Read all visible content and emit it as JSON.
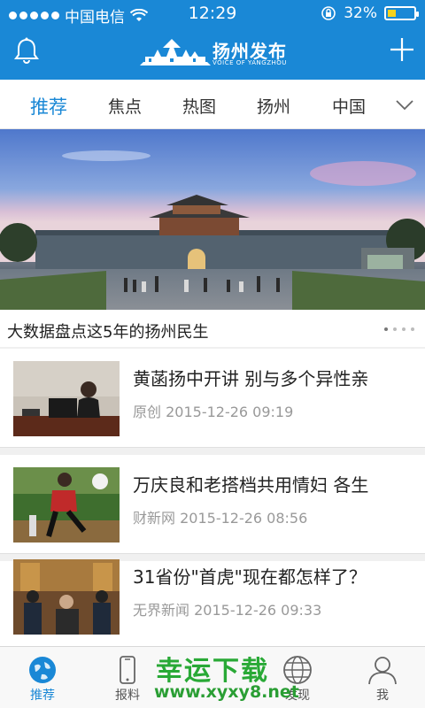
{
  "status_bar": {
    "carrier": "中国电信",
    "time": "12:29",
    "battery": "32%",
    "battery_level": 0.32
  },
  "header": {
    "brand_title": "扬州发布",
    "brand_subtitle": "VOICE OF YANGZHOU",
    "left_icon": "bell-icon",
    "right_icon": "plus-icon"
  },
  "tabs": [
    {
      "label": "推荐",
      "active": true
    },
    {
      "label": "焦点"
    },
    {
      "label": "热图"
    },
    {
      "label": "扬州"
    },
    {
      "label": "中国"
    }
  ],
  "banner": {
    "caption": "大数据盘点这5年的扬州民生",
    "pages": 4,
    "current_page": 1
  },
  "news": [
    {
      "title": "黄菡扬中开讲 别与多个异性亲",
      "source": "原创",
      "time": "2015-12-26 09:19"
    },
    {
      "title": "万庆良和老搭档共用情妇 各生",
      "source": "财新网",
      "time": "2015-12-26 08:56"
    },
    {
      "title": "31省份\"首虎\"现在都怎样了？",
      "source": "无界新闻",
      "time": "2015-12-26 09:33"
    }
  ],
  "bottom_nav": [
    {
      "label": "推荐",
      "icon": "globe-icon",
      "active": true
    },
    {
      "label": "报料",
      "icon": "phone-icon"
    },
    {
      "label": "",
      "icon": ""
    },
    {
      "label": "发现",
      "icon": "compass-icon"
    },
    {
      "label": "我",
      "icon": "user-icon"
    }
  ],
  "watermark": {
    "text": "幸运下载",
    "url": "www.xyxy8.net"
  },
  "colors": {
    "brand_blue": "#1a88d6",
    "watermark_green": "#29a936"
  }
}
